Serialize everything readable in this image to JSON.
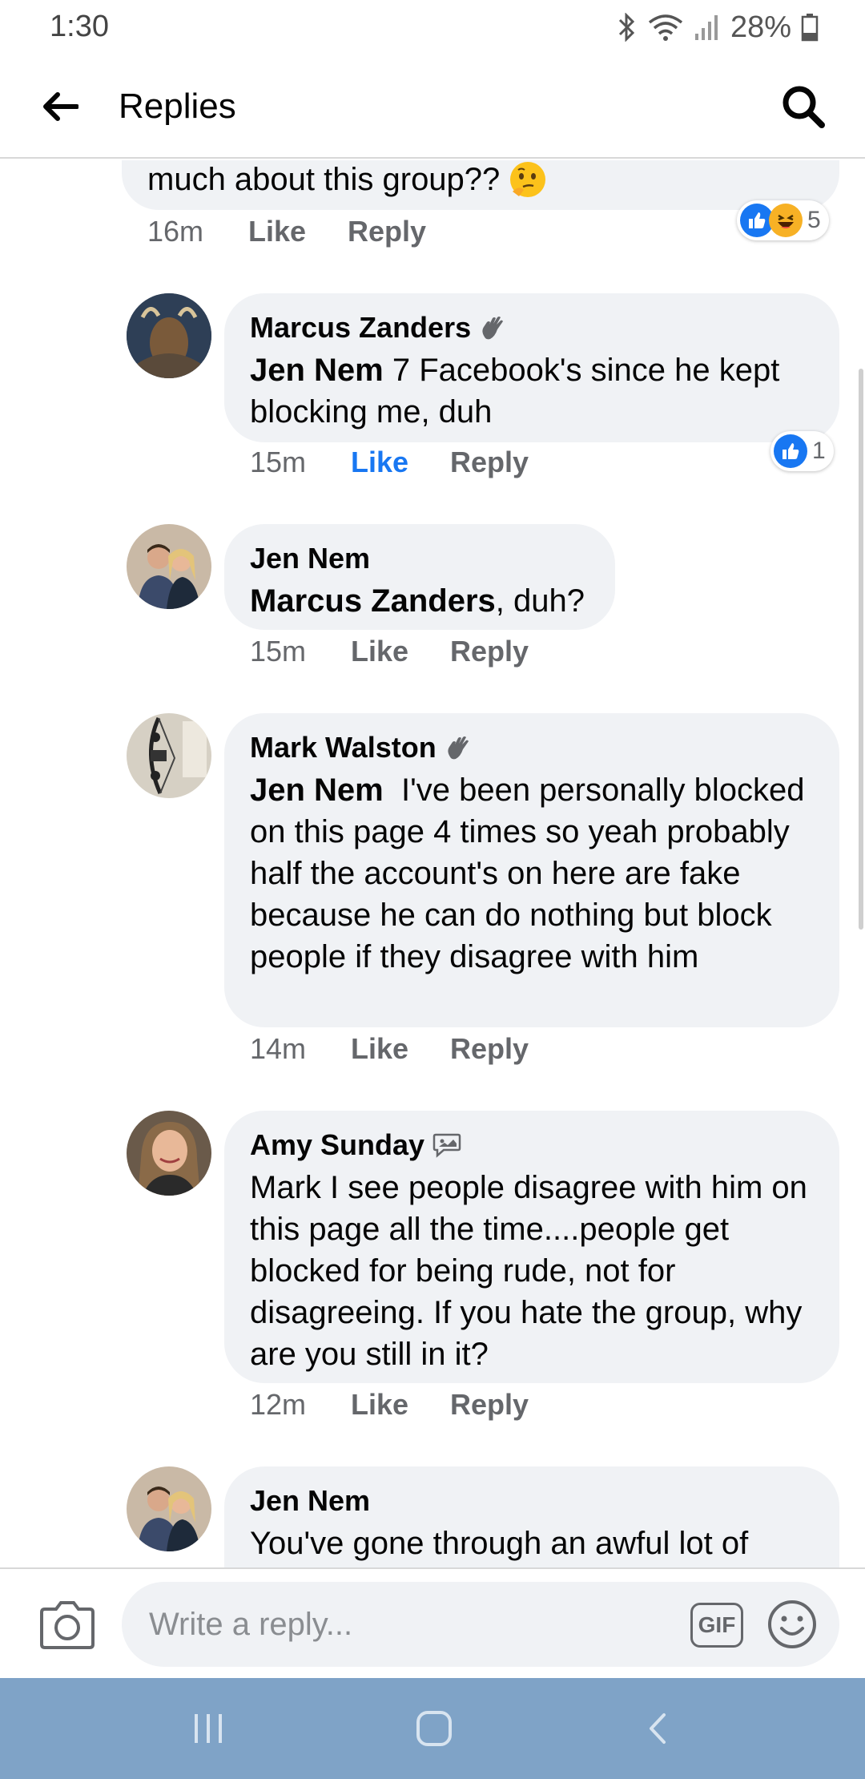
{
  "status_bar": {
    "time": "1:30",
    "battery": "28%",
    "icons": [
      "bluetooth-icon",
      "wifi-icon",
      "signal-icon",
      "battery-icon"
    ]
  },
  "header": {
    "title": "Replies",
    "back_icon": "arrow-left-icon",
    "search_icon": "search-icon"
  },
  "comments": [
    {
      "author": "",
      "text_visible": "much about this group??",
      "emoji": "thinking-face",
      "time": "16m",
      "like": "Like",
      "reply": "Reply",
      "liked": false,
      "reactions": {
        "types": [
          "like",
          "haha"
        ],
        "count": "5"
      }
    },
    {
      "author": "Marcus Zanders",
      "badge": "wave-badge-icon",
      "mention": "Jen Nem",
      "text": " 7 Facebook's since he kept blocking me, duh",
      "time": "15m",
      "like": "Like",
      "reply": "Reply",
      "liked": true,
      "reactions": {
        "types": [
          "like"
        ],
        "count": "1"
      }
    },
    {
      "author": "Jen Nem",
      "mention": "Marcus Zanders",
      "text": ", duh?",
      "time": "15m",
      "like": "Like",
      "reply": "Reply",
      "liked": false
    },
    {
      "author": "Mark Walston",
      "badge": "wave-badge-icon",
      "mention": "Jen Nem",
      "text": "  I've been personally blocked on this page 4 times so yeah probably half the account's on here are fake because he can do nothing but block people if they disagree with him",
      "time": "14m",
      "like": "Like",
      "reply": "Reply",
      "liked": false
    },
    {
      "author": "Amy Sunday",
      "badge": "conversation-starter-icon",
      "text": "Mark I see people disagree with him on this page all the time....people get blocked for being rude, not for disagreeing. If you hate the group, why are you still in it?",
      "time": "12m",
      "like": "Like",
      "reply": "Reply",
      "liked": false
    },
    {
      "author": "Jen Nem",
      "text": "You've gone through an awful lot of"
    }
  ],
  "composer": {
    "placeholder": "Write a reply...",
    "gif_label": "GIF",
    "camera_icon": "camera-icon",
    "emoji_icon": "smiley-icon"
  },
  "navbar": {
    "icons": [
      "recent-apps-icon",
      "home-icon",
      "back-icon"
    ]
  },
  "colors": {
    "accent": "#1877f2",
    "bubble": "#f0f2f5",
    "secondary_text": "#65676b",
    "navbar": "#7fa3c7"
  }
}
